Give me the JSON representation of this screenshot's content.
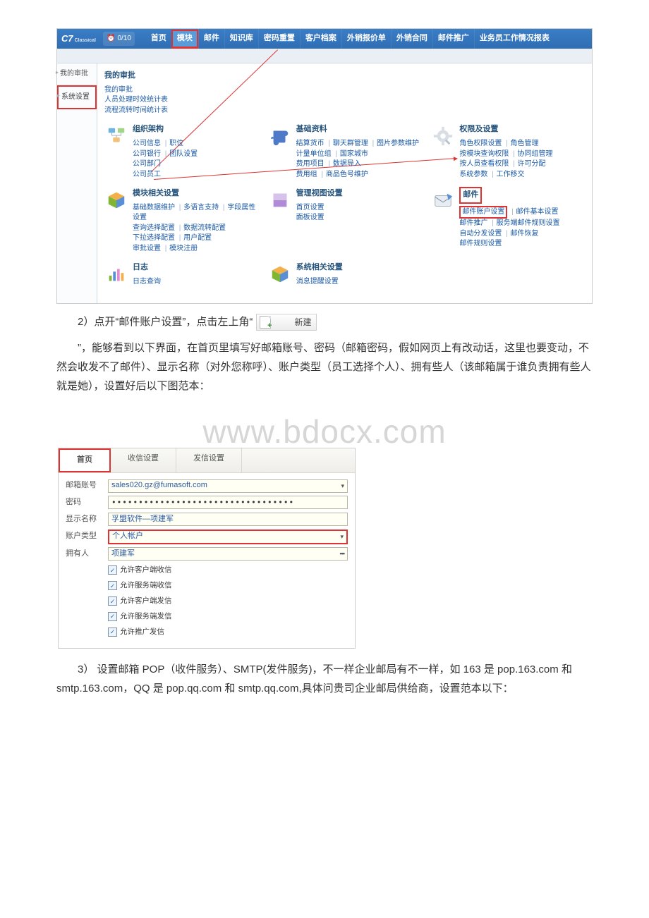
{
  "topbar": {
    "logo": "C7",
    "logo_sub": "Classical",
    "alarm_icon": "⏰",
    "alarm_count": "0/10",
    "menu": [
      "首页",
      "模块",
      "邮件",
      "知识库",
      "密码重置",
      "客户档案",
      "外销报价单",
      "外销合同",
      "邮件推广",
      "业务员工作情况报表"
    ],
    "highlight_index": 1
  },
  "sidebar": {
    "items": [
      "我的审批",
      "系统设置"
    ],
    "boxed_index": 1
  },
  "panel": {
    "approval": {
      "title": "我的审批",
      "links": [
        "我的审批",
        "人员处理时效统计表",
        "流程流转时间统计表"
      ]
    },
    "row1": [
      {
        "title": "组织架构",
        "icon": "org",
        "lines": [
          [
            "公司信息",
            "职位"
          ],
          [
            "公司银行",
            "团队设置"
          ],
          [
            "公司部门"
          ],
          [
            "公司员工"
          ]
        ]
      },
      {
        "title": "基础资料",
        "icon": "puzzle",
        "lines": [
          [
            "结算货币",
            "聊天群管理",
            "图片参数维护"
          ],
          [
            "计量单位组",
            "国家城市"
          ],
          [
            "费用项目",
            "数据导入"
          ],
          [
            "费用组",
            "商品色号维护"
          ]
        ]
      },
      {
        "title": "权限及设置",
        "icon": "gear",
        "lines": [
          [
            "角色权限设置",
            "角色管理"
          ],
          [
            "按模块查询权限",
            "协同组管理"
          ],
          [
            "按人员查看权限",
            "许可分配"
          ],
          [
            "系统参数",
            "工作移交"
          ]
        ]
      }
    ],
    "row2": [
      {
        "title": "模块相关设置",
        "icon": "cube1",
        "lines": [
          [
            "基础数据维护",
            "多语言支持",
            "字段属性设置"
          ],
          [
            "查询选择配置",
            "数据流转配置"
          ],
          [
            "下拉选择配置",
            "用户配置"
          ],
          [
            "审批设置",
            "模块注册"
          ]
        ]
      },
      {
        "title": "管理视图设置",
        "icon": "square",
        "lines": [
          [
            "首页设置"
          ],
          [
            "面板设置"
          ]
        ]
      },
      {
        "title": "邮件",
        "icon": "envelope",
        "boxed_title": true,
        "lines": [
          [
            "邮件账户设置",
            "邮件基本设置"
          ],
          [
            "邮件推广",
            "服务端邮件规则设置"
          ],
          [
            "自动分发设置",
            "邮件恢复"
          ],
          [
            "邮件规则设置"
          ]
        ],
        "boxed_first_link": true
      }
    ],
    "row3": [
      {
        "title": "日志",
        "icon": "chart",
        "lines": [
          [
            "日志查询"
          ]
        ]
      },
      {
        "title": "系统相关设置",
        "icon": "cube2",
        "lines": [
          [
            "消息提醒设置"
          ]
        ]
      }
    ]
  },
  "doc": {
    "p2a": "2）点开“邮件账户设置”，点击左上角“",
    "new_btn": "新建",
    "p2c": "”，能够看到以下界面，在首页里填写好邮箱账号、密码（邮箱密码，假如网页上有改动话，这里也要变动，不然会收发不了邮件）、显示名称（对外您称呼）、账户类型（员工选择个人）、拥有些人（该邮箱属于谁负责拥有些人就是她），设置好后以下图范本：",
    "watermark": "www.bdocx.com",
    "p3": "3） 设置邮箱 POP（收件服务）、SMTP(发件服务)，不一样企业邮局有不一样，如 163 是 pop.163.com 和 smtp.163.com，QQ 是 pop.qq.com 和 smtp.qq.com,具体问贵司企业邮局供给商，设置范本以下："
  },
  "form": {
    "tabs": [
      "首页",
      "收信设置",
      "发信设置"
    ],
    "active_tab": 0,
    "fields": {
      "account_label": "邮箱账号",
      "account_value": "sales020.gz@fumasoft.com",
      "password_label": "密码",
      "password_value": "••••••••••••••••••••••••••••••••••",
      "display_label": "显示名称",
      "display_value": "孚盟软件—项建军",
      "type_label": "账户类型",
      "type_value": "个人帐户",
      "owner_label": "拥有人",
      "owner_value": "项建军"
    },
    "checks": [
      "允许客户端收信",
      "允许服务端收信",
      "允许客户端发信",
      "允许服务端发信",
      "允许推广发信"
    ]
  }
}
